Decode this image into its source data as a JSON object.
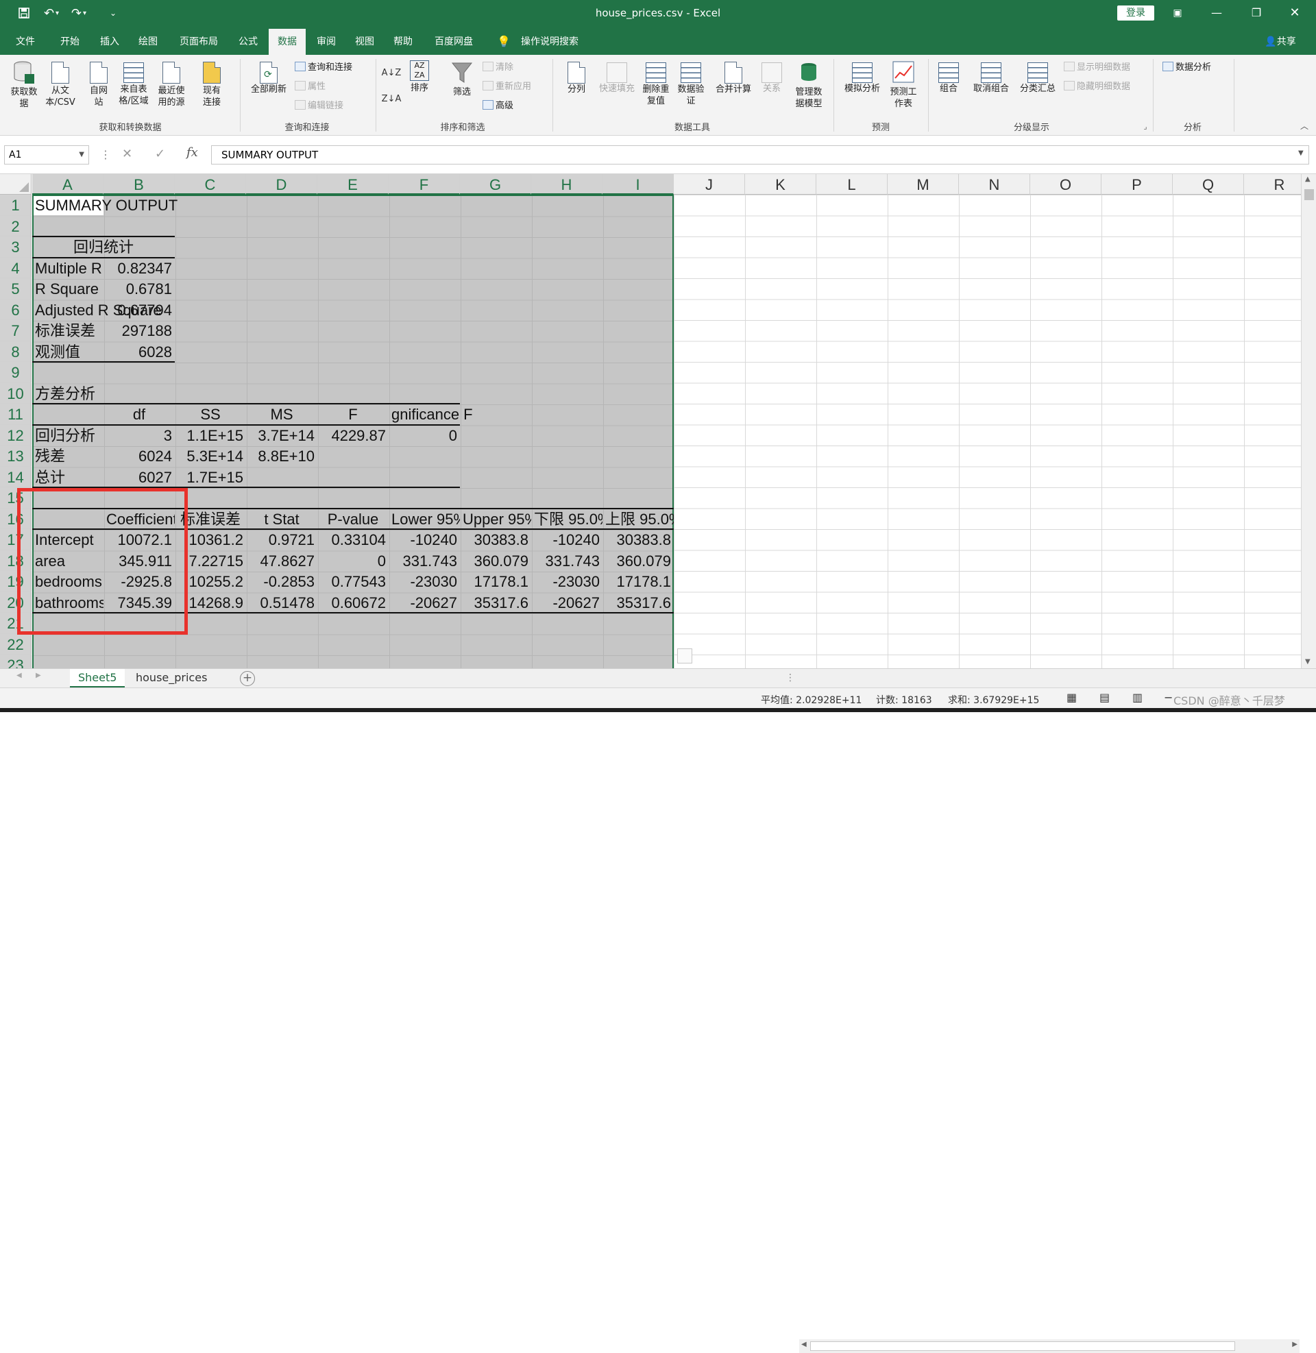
{
  "titlebar": {
    "title": "house_prices.csv  -  Excel",
    "login": "登录",
    "icons": [
      "save-icon",
      "undo-icon",
      "redo-icon",
      "customize-icon"
    ]
  },
  "tabs": [
    "文件",
    "开始",
    "插入",
    "绘图",
    "页面布局",
    "公式",
    "数据",
    "审阅",
    "视图",
    "帮助",
    "百度网盘",
    "操作说明搜索"
  ],
  "share": "共享",
  "ribbon": {
    "get_data": "获取数据",
    "from_text": "从文本/CSV",
    "from_web": "自网站",
    "from_table": "来自表格/区域",
    "recent": "最近使用的源",
    "existing": "现有连接",
    "group_get": "获取和转换数据",
    "refresh_all": "全部刷新",
    "queries": "查询和连接",
    "properties": "属性",
    "edit_links": "编辑链接",
    "group_query": "查询和连接",
    "sort": "排序",
    "filter": "筛选",
    "clear": "清除",
    "reapply": "重新应用",
    "advanced": "高级",
    "group_sort": "排序和筛选",
    "split": "分列",
    "flash_fill": "快速填充",
    "remove_dup": "删除重复值",
    "validation": "数据验证",
    "consolidate": "合并计算",
    "relations": "关系",
    "manage_model": "管理数据模型",
    "group_tools": "数据工具",
    "whatif": "模拟分析",
    "forecast": "预测工作表",
    "group_forecast": "预测",
    "group_btn": "组合",
    "ungroup": "取消组合",
    "subtotal": "分类汇总",
    "show_detail": "显示明细数据",
    "hide_detail": "隐藏明细数据",
    "group_outline": "分级显示",
    "data_analysis": "数据分析",
    "group_analysis": "分析"
  },
  "formula_bar": {
    "name_box": "A1",
    "fx": "fx",
    "content": "SUMMARY OUTPUT"
  },
  "columns": [
    "A",
    "B",
    "C",
    "D",
    "E",
    "F",
    "G",
    "H",
    "I",
    "J",
    "K",
    "L",
    "M",
    "N",
    "O",
    "P",
    "Q",
    "R"
  ],
  "rows": [
    "1",
    "2",
    "3",
    "4",
    "5",
    "6",
    "7",
    "8",
    "9",
    "10",
    "11",
    "12",
    "13",
    "14",
    "15",
    "16",
    "17",
    "18",
    "19",
    "20",
    "21",
    "22",
    "23"
  ],
  "cells": {
    "A1": "SUMMARY OUTPUT",
    "A3": "回归统计",
    "A4": "Multiple R",
    "B4": "0.82347",
    "A5": "R Square",
    "B5": "0.6781",
    "A6": "Adjusted R Square",
    "B6": "0.67794",
    "A7": "标准误差",
    "B7": "297188",
    "A8": "观测值",
    "B8": "6028",
    "A10": "方差分析",
    "B11": "df",
    "C11": "SS",
    "D11": "MS",
    "E11": "F",
    "F11": "gnificance F",
    "A12": "回归分析",
    "B12": "3",
    "C12": "1.1E+15",
    "D12": "3.7E+14",
    "E12": "4229.87",
    "F12": "0",
    "A13": "残差",
    "B13": "6024",
    "C13": "5.3E+14",
    "D13": "8.8E+10",
    "A14": "总计",
    "B14": "6027",
    "C14": "1.7E+15",
    "B16": "Coefficient",
    "C16": "标准误差",
    "D16": "t Stat",
    "E16": "P-value",
    "F16": "Lower 95%",
    "G16": "Upper 95%",
    "H16": "下限 95.0%",
    "I16": "上限 95.0%",
    "A17": "Intercept",
    "B17": "10072.1",
    "C17": "10361.2",
    "D17": "0.9721",
    "E17": "0.33104",
    "F17": "-10240",
    "G17": "30383.8",
    "H17": "-10240",
    "I17": "30383.8",
    "A18": "area",
    "B18": "345.911",
    "C18": "7.22715",
    "D18": "47.8627",
    "E18": "0",
    "F18": "331.743",
    "G18": "360.079",
    "H18": "331.743",
    "I18": "360.079",
    "A19": "bedrooms",
    "B19": "-2925.8",
    "C19": "10255.2",
    "D19": "-0.2853",
    "E19": "0.77543",
    "F19": "-23030",
    "G19": "17178.1",
    "H19": "-23030",
    "I19": "17178.1",
    "A20": "bathrooms",
    "B20": "7345.39",
    "C20": "14268.9",
    "D20": "0.51478",
    "E20": "0.60672",
    "F20": "-20627",
    "G20": "35317.6",
    "H20": "-20627",
    "I20": "35317.6"
  },
  "sheet_tabs": [
    "Sheet5",
    "house_prices"
  ],
  "add_sheet": "+",
  "status": {
    "average": "平均值: 2.02928E+11",
    "count": "计数: 18163",
    "sum": "求和: 3.67929E+15",
    "watermark": "CSDN @醉意丶千层梦"
  },
  "colors": {
    "excel_green": "#217346",
    "highlight_red": "#e8322c"
  }
}
